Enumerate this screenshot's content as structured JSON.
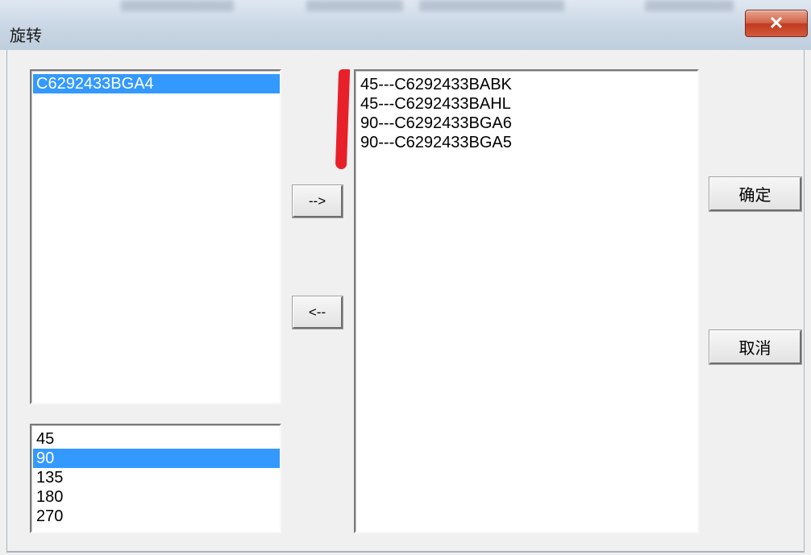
{
  "window": {
    "title": "旋转",
    "close_label": "✕"
  },
  "component_list": {
    "items": [
      {
        "label": "C6292433BGA4",
        "selected": true
      }
    ]
  },
  "angle_list": {
    "items": [
      {
        "label": "45",
        "selected": false
      },
      {
        "label": "90",
        "selected": true
      },
      {
        "label": "135",
        "selected": false
      },
      {
        "label": "180",
        "selected": false
      },
      {
        "label": "270",
        "selected": false
      }
    ]
  },
  "result_list": {
    "items": [
      {
        "label": "45---C6292433BABK"
      },
      {
        "label": "45---C6292433BAHL"
      },
      {
        "label": "90---C6292433BGA6"
      },
      {
        "label": "90---C6292433BGA5"
      }
    ]
  },
  "buttons": {
    "add_label": "-->",
    "remove_label": "<--",
    "ok_label": "确定",
    "cancel_label": "取消"
  },
  "colors": {
    "selection": "#3399ff",
    "annotation_mark": "#e8202a"
  }
}
